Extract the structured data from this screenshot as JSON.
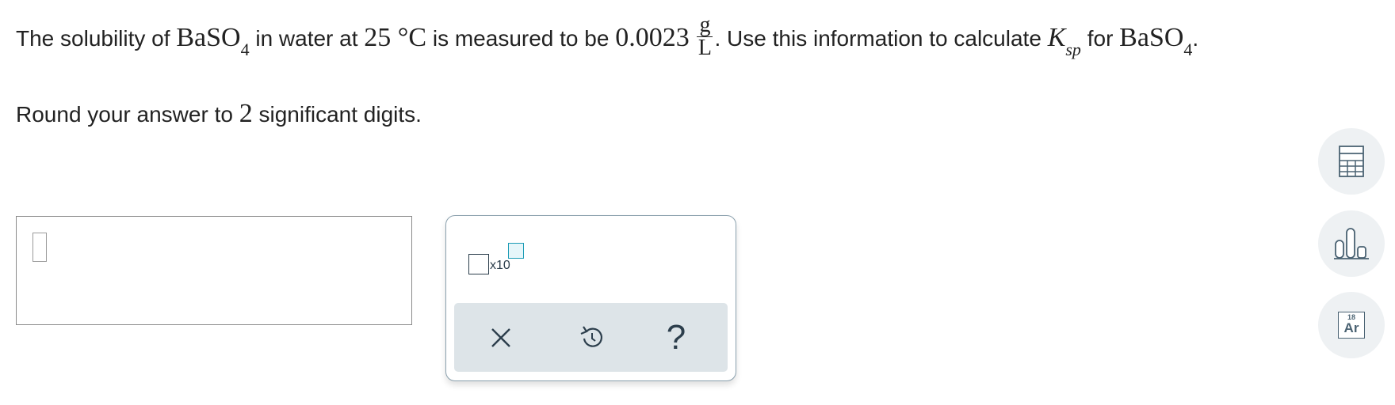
{
  "question": {
    "t1": "The solubility of ",
    "compound_base": "BaSO",
    "compound_sub": "4",
    "t2": " in water at ",
    "temperature": "25",
    "temp_unit": " °C",
    "t3": " is measured to be ",
    "value": "0.0023",
    "unit_num": "g",
    "unit_den": "L",
    "t4": ". Use this information to calculate ",
    "k_symbol": "K",
    "k_sub": "sp",
    "t5": " for ",
    "compound2_base": "BaSO",
    "compound2_sub": "4",
    "t6": "."
  },
  "round": {
    "t1": "Round your answer to ",
    "digits": "2",
    "t2": " significant digits."
  },
  "answer": {
    "value": ""
  },
  "keypad": {
    "sci_label": "x10",
    "clear_icon": "close-icon",
    "undo_icon": "undo-icon",
    "help_label": "?"
  },
  "side_tools": {
    "calculator_icon": "calculator-icon",
    "data_icon": "bar-chart-icon",
    "periodic_number": "18",
    "periodic_symbol": "Ar"
  },
  "colors": {
    "text": "#222222",
    "keypad_border": "#8aa0ad",
    "exponent_accent": "#1a9bb5",
    "action_bar": "#dde4e8",
    "side_button_bg": "#eef1f3",
    "icon": "#4a6272"
  }
}
